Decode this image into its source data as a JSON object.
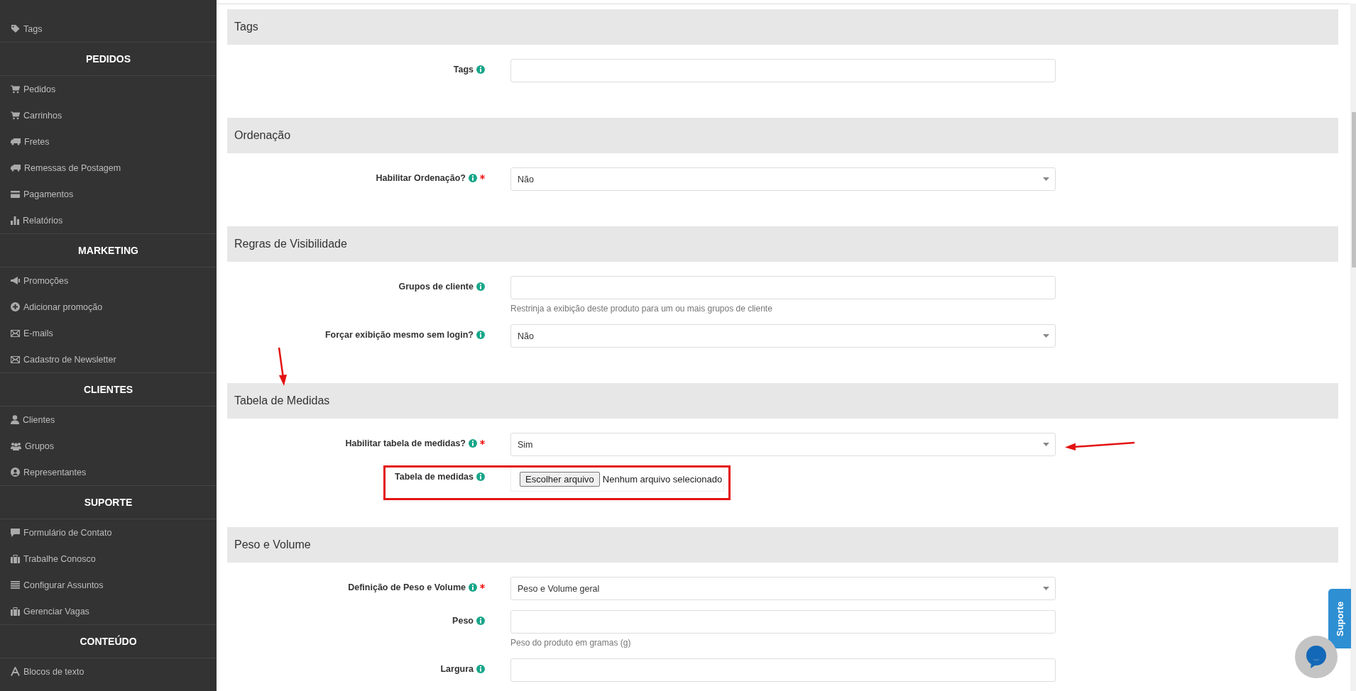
{
  "sidebar": {
    "groups": [
      {
        "items": [
          {
            "label": "Tags"
          }
        ]
      },
      {
        "heading": "PEDIDOS",
        "items": [
          {
            "label": "Pedidos"
          },
          {
            "label": "Carrinhos"
          },
          {
            "label": "Fretes"
          },
          {
            "label": "Remessas de Postagem"
          },
          {
            "label": "Pagamentos"
          },
          {
            "label": "Relatórios"
          }
        ]
      },
      {
        "heading": "MARKETING",
        "items": [
          {
            "label": "Promoções"
          },
          {
            "label": "Adicionar promoção"
          },
          {
            "label": "E-mails"
          },
          {
            "label": "Cadastro de Newsletter"
          }
        ]
      },
      {
        "heading": "CLIENTES",
        "items": [
          {
            "label": "Clientes"
          },
          {
            "label": "Grupos"
          },
          {
            "label": "Representantes"
          }
        ]
      },
      {
        "heading": "SUPORTE",
        "items": [
          {
            "label": "Formulário de Contato"
          },
          {
            "label": "Trabalhe Conosco"
          },
          {
            "label": "Configurar Assuntos"
          },
          {
            "label": "Gerenciar Vagas"
          }
        ]
      },
      {
        "heading": "CONTEÚDO",
        "items": [
          {
            "label": "Blocos de texto"
          }
        ]
      }
    ]
  },
  "sections": [
    {
      "title": "Tags",
      "fields": [
        {
          "label": "Tags",
          "required": false,
          "kind": "text"
        }
      ]
    },
    {
      "title": "Ordenação",
      "fields": [
        {
          "label": "Habilitar Ordenação?",
          "required": true,
          "kind": "select",
          "value": "Não"
        }
      ]
    },
    {
      "title": "Regras de Visibilidade",
      "fields": [
        {
          "label": "Grupos de cliente",
          "required": false,
          "kind": "text",
          "help": "Restrinja a exibição deste produto para um ou mais grupos de cliente"
        },
        {
          "label": "Forçar exibição mesmo sem login?",
          "required": false,
          "kind": "select",
          "value": "Não"
        }
      ]
    },
    {
      "title": "Tabela de Medidas",
      "fields": [
        {
          "label": "Habilitar tabela de medidas?",
          "required": true,
          "kind": "select",
          "value": "Sim"
        },
        {
          "label": "Tabela de medidas",
          "required": false,
          "kind": "file",
          "button": "Escolher arquivo",
          "status": "Nenhum arquivo selecionado"
        }
      ]
    },
    {
      "title": "Peso e Volume",
      "fields": [
        {
          "label": "Definição de Peso e Volume",
          "required": true,
          "kind": "select",
          "value": "Peso e Volume geral"
        },
        {
          "label": "Peso",
          "required": false,
          "kind": "text",
          "help": "Peso do produto em gramas (g)"
        },
        {
          "label": "Largura",
          "required": false,
          "kind": "text"
        }
      ]
    }
  ],
  "support_tab": "Suporte"
}
